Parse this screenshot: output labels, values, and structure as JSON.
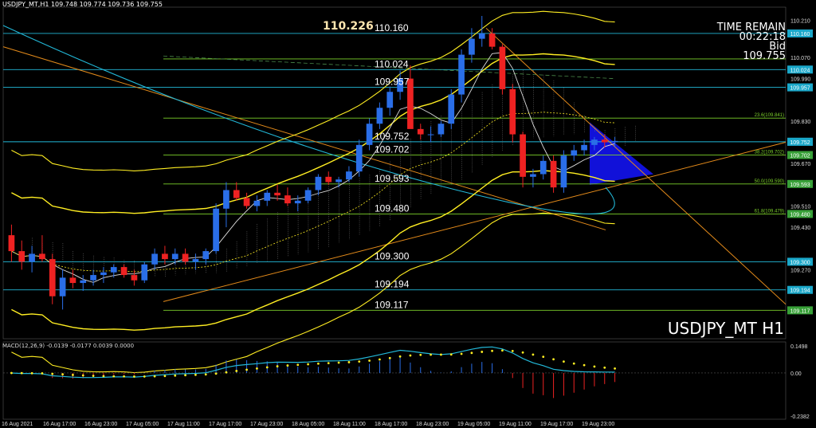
{
  "header": {
    "symbol_info": "USDJPY_MT,H1  109.748 109.774 109.736 109.755"
  },
  "info_panel": {
    "line1": "TIME REMAIN",
    "line2": "00:22:18",
    "line3": "Bid",
    "line4": "109.755"
  },
  "symbol_big": "USDJPY_MT H1",
  "high_label": "110.226",
  "macd_label": "MACD(12,26,9) -0.0139 -0.0177 0.0039 0.0000",
  "colors": {
    "bull": "#2a6ee8",
    "bear": "#ee2222",
    "band": "#ffee22",
    "cyan": "#22b8d8",
    "orange": "#e38a1a",
    "green_level": "#7bcf2a",
    "fill": "#1414ff"
  },
  "chart_data": {
    "type": "candlestick",
    "price_axis": {
      "min": 109.01,
      "max": 110.25,
      "ticks": [
        "110.210",
        "110.070",
        "109.990",
        "109.830",
        "109.670",
        "109.510",
        "109.430",
        "109.270"
      ]
    },
    "x_labels": [
      "16 Aug 2021",
      "16 Aug 17:00",
      "16 Aug 23:00",
      "17 Aug 05:00",
      "17 Aug 11:00",
      "17 Aug 17:00",
      "17 Aug 23:00",
      "18 Aug 05:00",
      "18 Aug 11:00",
      "18 Aug 17:00",
      "18 Aug 23:00",
      "19 Aug 05:00",
      "19 Aug 11:00",
      "19 Aug 17:00",
      "19 Aug 23:00"
    ],
    "levels": [
      {
        "price": 110.16,
        "label": "110.160",
        "tag": "110.160",
        "color": "cyan"
      },
      {
        "price": 110.064,
        "label": "",
        "tag": "",
        "fib": "",
        "color": "green"
      },
      {
        "price": 110.024,
        "label": "110.024",
        "tag": "110.024",
        "color": "cyan"
      },
      {
        "price": 109.957,
        "label": "109.957",
        "tag": "109.957",
        "color": "cyan"
      },
      {
        "price": 109.841,
        "label": "",
        "tag": "",
        "fib": "23.6(109.841)",
        "color": "green"
      },
      {
        "price": 109.752,
        "label": "109.752",
        "tag": "109.752",
        "color": "cyan"
      },
      {
        "price": 109.702,
        "label": "109.702",
        "tag": "109.702",
        "fib": "38.2(109.702)",
        "color": "green"
      },
      {
        "price": 109.593,
        "label": "109.593",
        "tag": "109.593",
        "fib": "50.0(109.590)",
        "color": "green"
      },
      {
        "price": 109.48,
        "label": "109.480",
        "tag": "109.480",
        "fib": "61.8(109.479)",
        "color": "green"
      },
      {
        "price": 109.3,
        "label": "109.300",
        "tag": "109.300",
        "color": "cyan"
      },
      {
        "price": 109.194,
        "label": "109.194",
        "tag": "109.194",
        "color": "cyan"
      },
      {
        "price": 109.117,
        "label": "109.117",
        "tag": "109.117",
        "color": "green"
      }
    ],
    "current_price": "109.752",
    "candles": [
      [
        109.4,
        109.44,
        109.3,
        109.34
      ],
      [
        109.34,
        109.38,
        109.27,
        109.3
      ],
      [
        109.3,
        109.36,
        109.26,
        109.33
      ],
      [
        109.33,
        109.4,
        109.3,
        109.31
      ],
      [
        109.31,
        109.33,
        109.14,
        109.17
      ],
      [
        109.17,
        109.27,
        109.12,
        109.24
      ],
      [
        109.24,
        109.27,
        109.2,
        109.22
      ],
      [
        109.22,
        109.25,
        109.19,
        109.23
      ],
      [
        109.23,
        109.27,
        109.21,
        109.25
      ],
      [
        109.25,
        109.28,
        109.22,
        109.26
      ],
      [
        109.26,
        109.29,
        109.24,
        109.28
      ],
      [
        109.28,
        109.29,
        109.24,
        109.25
      ],
      [
        109.25,
        109.27,
        109.21,
        109.23
      ],
      [
        109.23,
        109.3,
        109.22,
        109.29
      ],
      [
        109.29,
        109.35,
        109.27,
        109.33
      ],
      [
        109.33,
        109.36,
        109.29,
        109.31
      ],
      [
        109.31,
        109.35,
        109.29,
        109.33
      ],
      [
        109.33,
        109.35,
        109.29,
        109.3
      ],
      [
        109.3,
        109.33,
        109.27,
        109.31
      ],
      [
        109.31,
        109.35,
        109.29,
        109.34
      ],
      [
        109.34,
        109.52,
        109.33,
        109.5
      ],
      [
        109.5,
        109.6,
        109.43,
        109.57
      ],
      [
        109.57,
        109.6,
        109.53,
        109.54
      ],
      [
        109.54,
        109.56,
        109.5,
        109.51
      ],
      [
        109.51,
        109.55,
        109.49,
        109.53
      ],
      [
        109.53,
        109.57,
        109.51,
        109.56
      ],
      [
        109.56,
        109.59,
        109.53,
        109.55
      ],
      [
        109.55,
        109.58,
        109.51,
        109.52
      ],
      [
        109.52,
        109.55,
        109.49,
        109.53
      ],
      [
        109.53,
        109.58,
        109.52,
        109.57
      ],
      [
        109.57,
        109.63,
        109.55,
        109.62
      ],
      [
        109.62,
        109.64,
        109.59,
        109.6
      ],
      [
        109.6,
        109.62,
        109.58,
        109.61
      ],
      [
        109.61,
        109.66,
        109.6,
        109.64
      ],
      [
        109.64,
        109.76,
        109.62,
        109.74
      ],
      [
        109.74,
        109.84,
        109.72,
        109.82
      ],
      [
        109.82,
        109.9,
        109.8,
        109.88
      ],
      [
        109.88,
        109.96,
        109.85,
        109.94
      ],
      [
        109.94,
        110.02,
        109.91,
        109.99
      ],
      [
        109.99,
        110.04,
        109.89,
        109.8
      ],
      [
        109.8,
        109.82,
        109.76,
        109.78
      ],
      [
        109.78,
        109.81,
        109.75,
        109.78
      ],
      [
        109.78,
        109.83,
        109.77,
        109.82
      ],
      [
        109.82,
        109.95,
        109.8,
        109.93
      ],
      [
        109.93,
        110.1,
        109.9,
        110.08
      ],
      [
        110.08,
        110.18,
        110.05,
        110.14
      ],
      [
        110.14,
        110.226,
        110.11,
        110.16
      ],
      [
        110.16,
        110.18,
        110.1,
        110.11
      ],
      [
        110.11,
        110.12,
        109.93,
        109.95
      ],
      [
        109.95,
        109.97,
        109.75,
        109.78
      ],
      [
        109.78,
        109.79,
        109.58,
        109.62
      ],
      [
        109.62,
        109.65,
        109.58,
        109.63
      ],
      [
        109.63,
        109.7,
        109.61,
        109.68
      ],
      [
        109.68,
        109.7,
        109.56,
        109.58
      ],
      [
        109.58,
        109.72,
        109.56,
        109.7
      ],
      [
        109.7,
        109.74,
        109.68,
        109.72
      ],
      [
        109.72,
        109.76,
        109.7,
        109.74
      ],
      [
        109.74,
        109.77,
        109.72,
        109.76
      ],
      [
        109.76,
        109.78,
        109.73,
        109.75
      ],
      [
        109.75,
        109.77,
        109.73,
        109.755
      ]
    ],
    "macd": {
      "y_ticks": [
        "0.1498",
        "0.00",
        "-0.2382"
      ],
      "min": -0.2382,
      "max": 0.1498
    }
  }
}
